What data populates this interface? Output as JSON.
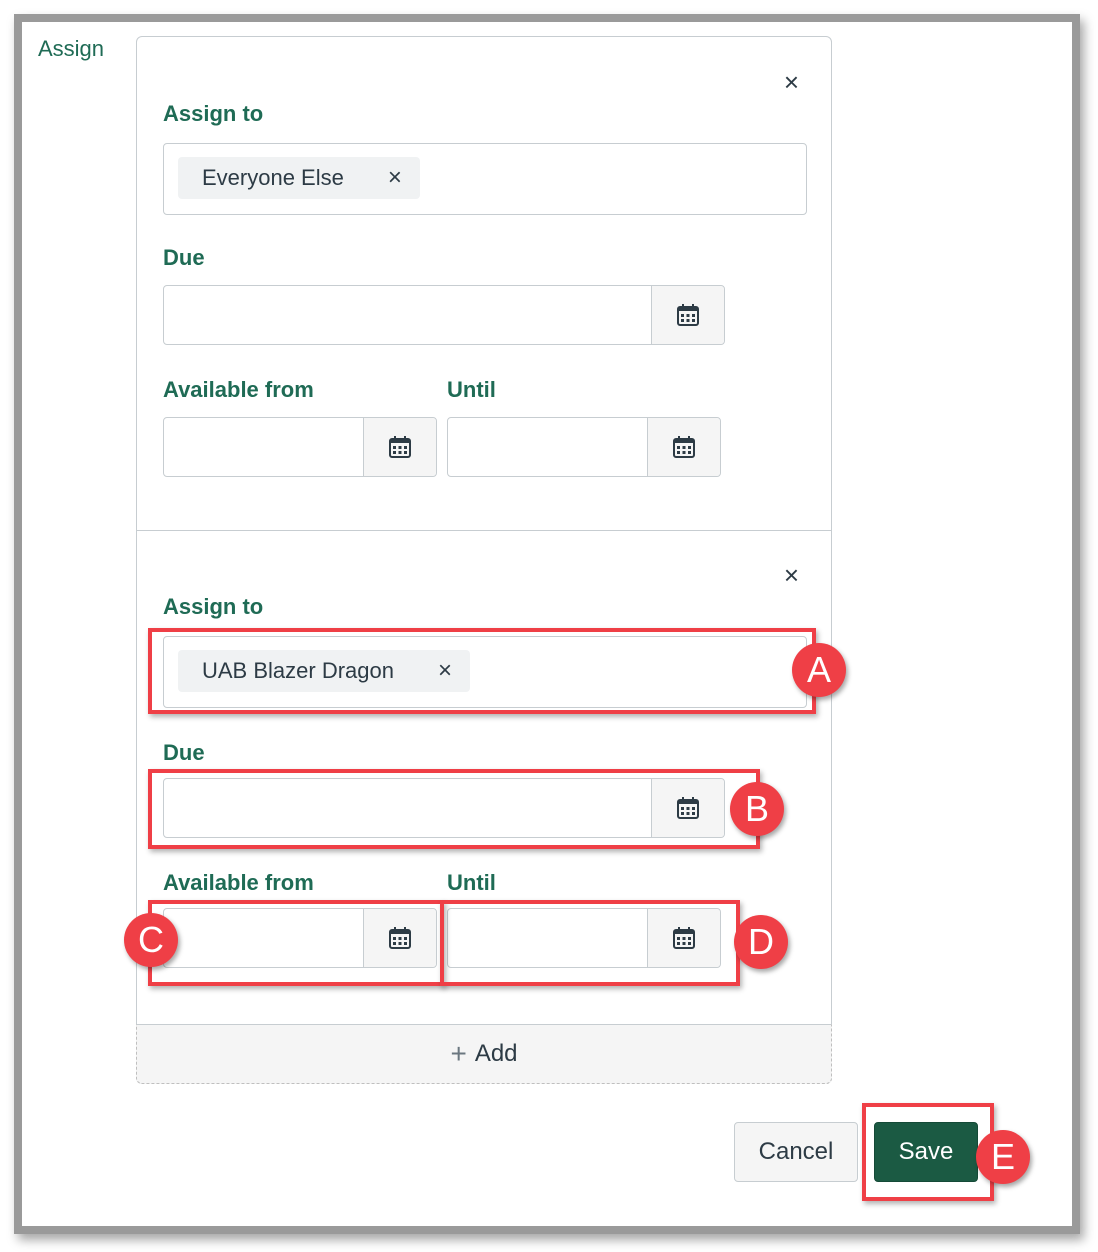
{
  "page": {
    "section_label": "Assign"
  },
  "assignments": [
    {
      "assign_to_label": "Assign to",
      "assignees": [
        "Everyone Else"
      ],
      "due_label": "Due",
      "due_value": "",
      "available_from_label": "Available from",
      "available_from_value": "",
      "until_label": "Until",
      "until_value": ""
    },
    {
      "assign_to_label": "Assign to",
      "assignees": [
        "UAB Blazer Dragon"
      ],
      "due_label": "Due",
      "due_value": "",
      "available_from_label": "Available from",
      "available_from_value": "",
      "until_label": "Until",
      "until_value": ""
    }
  ],
  "icons": {
    "close": "×",
    "remove_pill": "×",
    "calendar": "calendar-icon",
    "plus": "+"
  },
  "add_button": {
    "icon": "+",
    "label": "Add"
  },
  "footer": {
    "cancel_label": "Cancel",
    "save_label": "Save"
  },
  "annotations": {
    "color": "#ef3f46",
    "labels": [
      "A",
      "B",
      "C",
      "D",
      "E"
    ]
  },
  "colors": {
    "heading_green": "#1f6b55",
    "save_button": "#1b5a43",
    "text": "#2d3b45"
  }
}
